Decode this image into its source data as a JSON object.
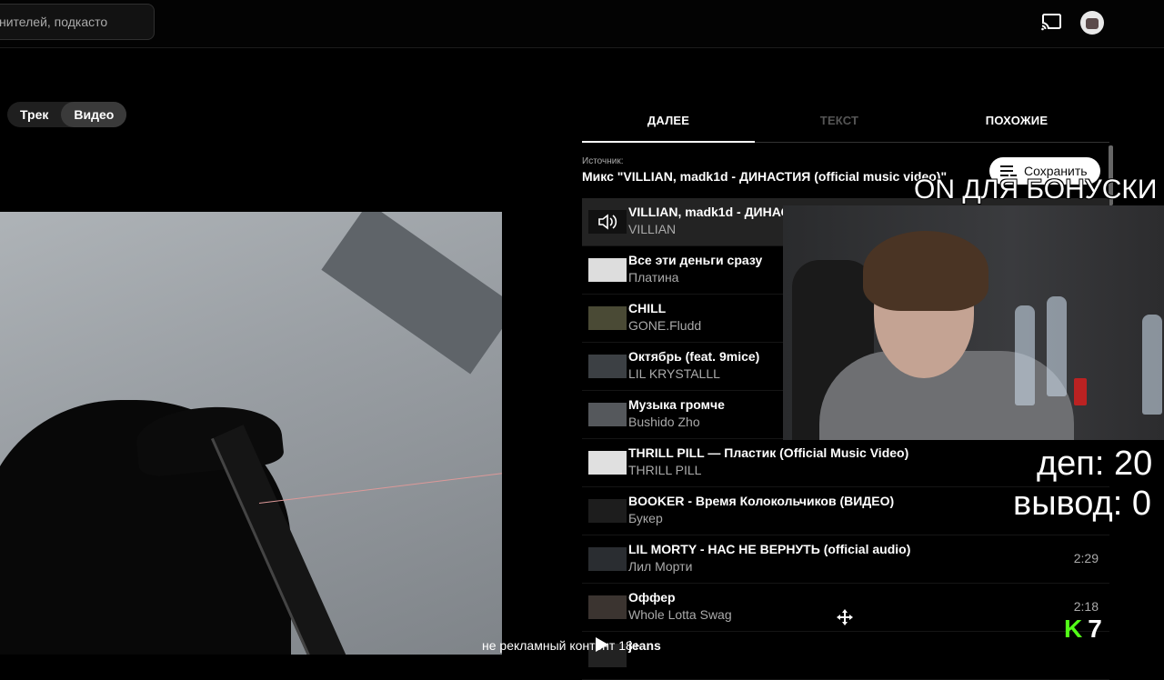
{
  "header": {
    "search_placeholder": "нителей, подкасто",
    "cast_icon": "cast-icon",
    "avatar_icon": "avatar"
  },
  "player_toggle": {
    "track_label": "Трек",
    "video_label": "Видео",
    "selected": "Видео"
  },
  "tabs": [
    {
      "label": "ДАЛЕЕ",
      "selected": true
    },
    {
      "label": "ТЕКСТ",
      "selected": false
    },
    {
      "label": "ПОХОЖИЕ",
      "selected": false
    }
  ],
  "queue_header": {
    "source_label": "Источник:",
    "source_title": "Микс \"VILLIAN, madk1d - ДИНАСТИЯ (official music video)\"",
    "save_label": "Сохранить"
  },
  "queue": [
    {
      "title": "VILLIAN, madk1d - ДИНАС",
      "artist": "VILLIAN",
      "duration": "",
      "playing": true
    },
    {
      "title": "Все эти деньги сразу",
      "artist": "Платина",
      "duration": "",
      "playing": false
    },
    {
      "title": "CHILL",
      "artist": "GONE.Fludd",
      "duration": "",
      "playing": false
    },
    {
      "title": "Октябрь (feat. 9mice)",
      "artist": "LIL KRYSTALLL",
      "duration": "",
      "playing": false
    },
    {
      "title": "Музыка громче",
      "artist": "Bushido Zho",
      "duration": "",
      "playing": false
    },
    {
      "title": "THRILL PILL — Пластик (Official Music Video)",
      "artist": "THRILL PILL",
      "duration": "",
      "playing": false
    },
    {
      "title": "BOOKER - Время Колокольчиков (ВИДЕО)",
      "artist": "Букер",
      "duration": "",
      "playing": false
    },
    {
      "title": "LIL MORTY - НАС НЕ ВЕРНУТЬ (official audio)",
      "artist": "Лил Морти",
      "duration": "2:29",
      "playing": false
    },
    {
      "title": "Оффер",
      "artist": "Whole Lotta Swag",
      "duration": "2:18",
      "playing": false
    },
    {
      "title": "jeans",
      "artist": "",
      "duration": "",
      "playing": false
    }
  ],
  "stream_overlay": {
    "bonus_text": "ON ДЛЯ БОНУСКИ",
    "dep_text": "деп: 20",
    "vyvod_text": "вывод: 0",
    "ad_note": "не рекламный контент 18+",
    "kick_logo": "K",
    "viewer_count": "7"
  }
}
